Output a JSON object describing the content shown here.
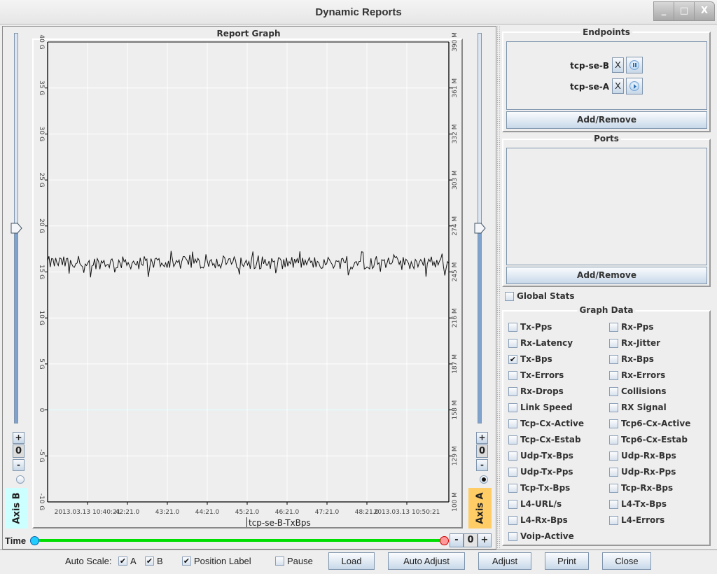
{
  "window": {
    "title": "Dynamic Reports",
    "controls": {
      "minimize": "_",
      "maximize": "□",
      "close": "X"
    }
  },
  "graph": {
    "title": "Report Graph",
    "series_label": "tcp-se-B-TxBps"
  },
  "chart_data": {
    "type": "line",
    "title": "Report Graph",
    "xlabel": "",
    "ylabel_left": "Axis B",
    "ylabel_right": "Axis A",
    "x_tick_labels": [
      "2013.03.13 10:40:21",
      "42:21.0",
      "43:21.0",
      "44:21.0",
      "45:21.0",
      "46:21.0",
      "47:21.0",
      "48:21.0",
      "2013.03.13 10:50:21"
    ],
    "y_left": {
      "unit": "G",
      "range": [
        -10,
        40
      ],
      "tick_labels": [
        "40 G",
        "35 G",
        "30 G",
        "25 G",
        "20 G",
        "15 G",
        "10 G",
        "5 G",
        "0",
        "-5 G",
        "-10 G"
      ]
    },
    "y_right": {
      "unit": "M",
      "range": [
        100,
        390
      ],
      "tick_labels": [
        "390 M",
        "361 M",
        "332 M",
        "303 M",
        "274 M",
        "245 M",
        "216 M",
        "187 M",
        "158 M",
        "129 M",
        "100 M"
      ]
    },
    "grid": true,
    "legend": "bottom-center",
    "series": [
      {
        "name": "tcp-se-B-TxBps",
        "axis": "left",
        "mean": 16.0,
        "noise_band": [
          14.3,
          17.3
        ],
        "samples": 300
      }
    ]
  },
  "axis_b": {
    "label": "Axis B",
    "value": "0",
    "plus": "+",
    "minus": "-",
    "selected": false,
    "color": "#ccffff"
  },
  "axis_a": {
    "label": "Axis A",
    "value": "0",
    "plus": "+",
    "minus": "-",
    "selected": true,
    "color": "#ffcc66"
  },
  "time": {
    "label": "Time",
    "minus": "-",
    "value": "0",
    "plus": "+"
  },
  "endpoints": {
    "title": "Endpoints",
    "items": [
      {
        "name": "tcp-se-B",
        "remove": "X",
        "state": "pause-icon"
      },
      {
        "name": "tcp-se-A",
        "remove": "X",
        "state": "play-icon"
      }
    ],
    "add_remove": "Add/Remove"
  },
  "ports": {
    "title": "Ports",
    "add_remove": "Add/Remove"
  },
  "global_stats": {
    "label": "Global Stats",
    "checked": false
  },
  "graph_data": {
    "title": "Graph Data",
    "left": [
      {
        "label": "Tx-Pps",
        "checked": false
      },
      {
        "label": "Rx-Latency",
        "checked": false
      },
      {
        "label": "Tx-Bps",
        "checked": true
      },
      {
        "label": "Tx-Errors",
        "checked": false
      },
      {
        "label": "Rx-Drops",
        "checked": false
      },
      {
        "label": "Link Speed",
        "checked": false
      },
      {
        "label": "Tcp-Cx-Active",
        "checked": false
      },
      {
        "label": "Tcp-Cx-Estab",
        "checked": false
      },
      {
        "label": "Udp-Tx-Bps",
        "checked": false
      },
      {
        "label": "Udp-Tx-Pps",
        "checked": false
      },
      {
        "label": "Tcp-Tx-Bps",
        "checked": false
      },
      {
        "label": "L4-URL/s",
        "checked": false
      },
      {
        "label": "L4-Rx-Bps",
        "checked": false
      },
      {
        "label": "Voip-Active",
        "checked": false
      }
    ],
    "right": [
      {
        "label": "Rx-Pps",
        "checked": false
      },
      {
        "label": "Rx-Jitter",
        "checked": false
      },
      {
        "label": "Rx-Bps",
        "checked": false
      },
      {
        "label": "Rx-Errors",
        "checked": false
      },
      {
        "label": "Collisions",
        "checked": false
      },
      {
        "label": "RX Signal",
        "checked": false
      },
      {
        "label": "Tcp6-Cx-Active",
        "checked": false
      },
      {
        "label": "Tcp6-Cx-Estab",
        "checked": false
      },
      {
        "label": "Udp-Rx-Bps",
        "checked": false
      },
      {
        "label": "Udp-Rx-Pps",
        "checked": false
      },
      {
        "label": "Tcp-Rx-Bps",
        "checked": false
      },
      {
        "label": "L4-Tx-Bps",
        "checked": false
      },
      {
        "label": "L4-Errors",
        "checked": false
      }
    ]
  },
  "bottom_bar": {
    "auto_scale_label": "Auto Scale:",
    "auto_scale_a": {
      "label": "A",
      "checked": true
    },
    "auto_scale_b": {
      "label": "B",
      "checked": true
    },
    "position_label": {
      "label": "Position Label",
      "checked": true
    },
    "pause": {
      "label": "Pause",
      "checked": false
    },
    "buttons": {
      "load": "Load",
      "auto_adjust": "Auto Adjust",
      "adjust": "Adjust",
      "print": "Print",
      "close": "Close"
    }
  }
}
